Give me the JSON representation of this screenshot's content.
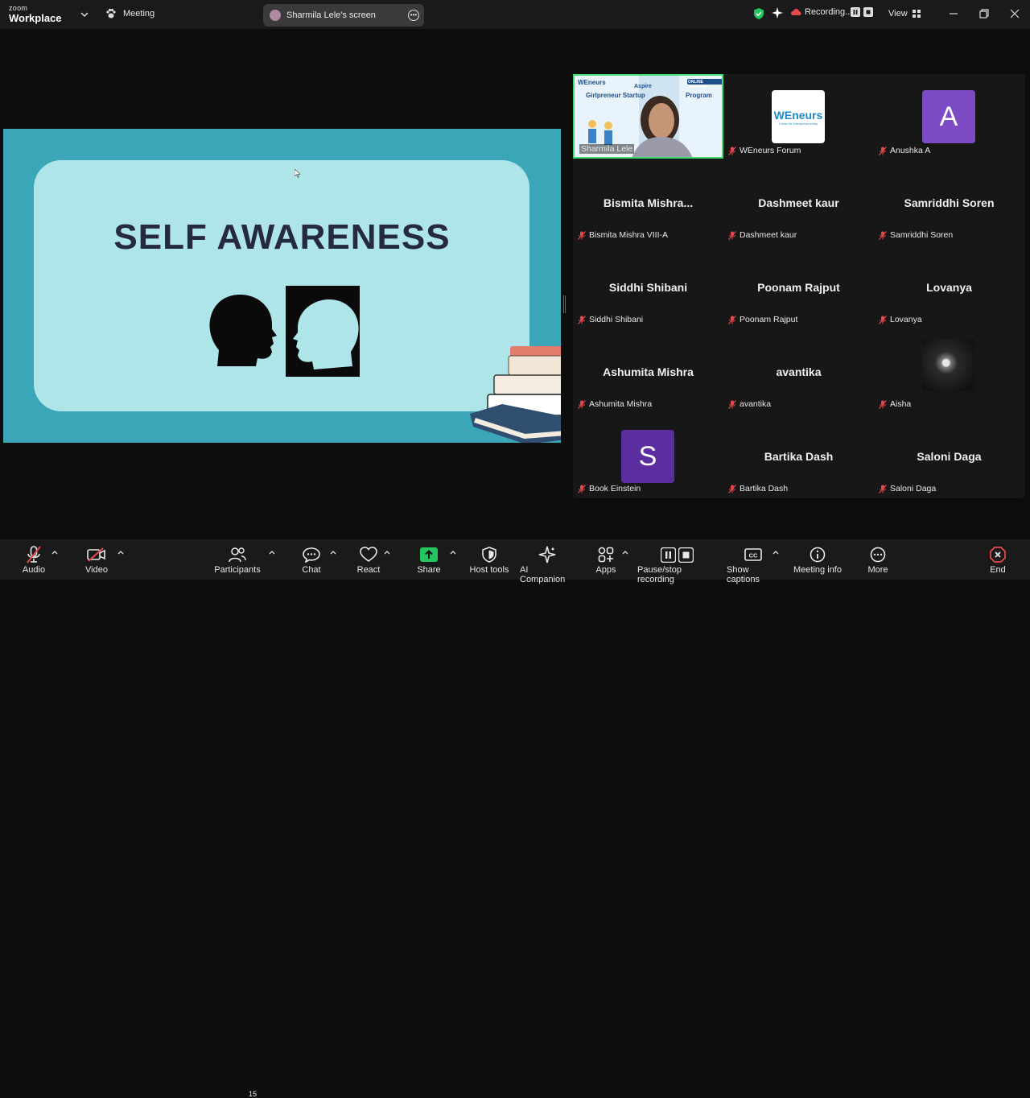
{
  "topbar": {
    "brand_small": "zoom",
    "brand_big": "Workplace",
    "meeting_label": "Meeting",
    "shared_screen_label": "Sharmila Lele's screen",
    "recording_label": "Recording...",
    "view_label": "View"
  },
  "slide": {
    "title": "SELF AWARENESS"
  },
  "gallery": {
    "tiles": [
      {
        "display": "",
        "label": "Sharmila Lele",
        "active_speaker": true,
        "video_banner": {
          "org": "WEneurs",
          "session": "ONLINE SESSION",
          "line1": "Aspire",
          "line2": "Girlpreneur Startup",
          "line3": "Program"
        }
      },
      {
        "display": "",
        "label": "WEneurs Forum",
        "logo_text": "WEneurs",
        "logo_sub": "Credo for Entrepreneurship"
      },
      {
        "display": "A",
        "label": "Anushka A",
        "avatar_color": "#7d4bc4"
      },
      {
        "display": "Bismita  Mishra...",
        "label": "Bismita Mishra VIII-A"
      },
      {
        "display": "Dashmeet kaur",
        "label": "Dashmeet kaur"
      },
      {
        "display": "Samriddhi Soren",
        "label": "Samriddhi Soren"
      },
      {
        "display": "Siddhi Shibani",
        "label": "Siddhi Shibani"
      },
      {
        "display": "Poonam Rajput",
        "label": "Poonam Rajput"
      },
      {
        "display": "Lovanya",
        "label": "Lovanya"
      },
      {
        "display": "Ashumita Mishra",
        "label": "Ashumita Mishra"
      },
      {
        "display": "avantika",
        "label": "avantika"
      },
      {
        "display": "",
        "label": "Aisha",
        "photo": true
      },
      {
        "display": "S",
        "label": "Book Einstein",
        "avatar_color": "#5b2d9e"
      },
      {
        "display": "Bartika Dash",
        "label": "Bartika Dash"
      },
      {
        "display": "Saloni Daga",
        "label": "Saloni Daga"
      }
    ]
  },
  "toolbar": {
    "audio": "Audio",
    "video": "Video",
    "participants": "Participants",
    "participants_count": "15",
    "chat": "Chat",
    "react": "React",
    "share": "Share",
    "host_tools": "Host tools",
    "ai_companion": "AI Companion",
    "apps": "Apps",
    "pause_stop_recording": "Pause/stop recording",
    "show_captions": "Show captions",
    "meeting_info": "Meeting info",
    "more": "More",
    "end": "End"
  },
  "colors": {
    "share_green": "#22c55e",
    "end_red": "#e5484d",
    "active_speaker_border": "#3ddc6c",
    "slide_teal": "#3aa6b8",
    "slide_card": "#aee5e9"
  }
}
